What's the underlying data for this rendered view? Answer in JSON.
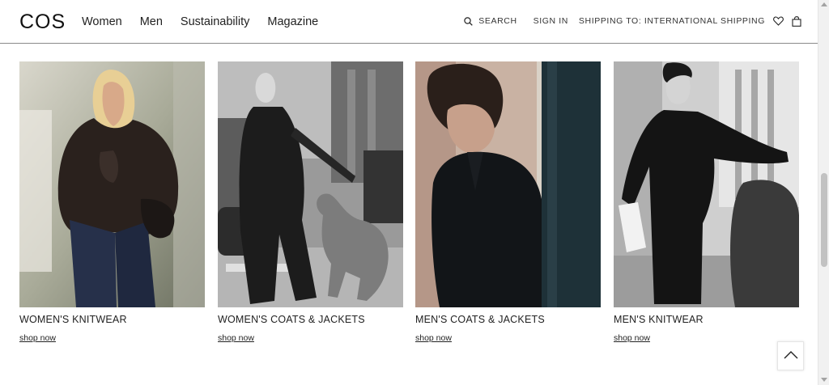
{
  "header": {
    "logo": "COS",
    "nav": [
      "Women",
      "Men",
      "Sustainability",
      "Magazine"
    ],
    "search_label": "SEARCH",
    "signin_label": "SIGN IN",
    "shipping_label": "SHIPPING TO: INTERNATIONAL SHIPPING"
  },
  "tiles": [
    {
      "title": "WOMEN'S KNITWEAR",
      "link": "shop now"
    },
    {
      "title": "WOMEN'S COATS & JACKETS",
      "link": "shop now"
    },
    {
      "title": "MEN'S COATS & JACKETS",
      "link": "shop now"
    },
    {
      "title": "MEN'S KNITWEAR",
      "link": "shop now"
    }
  ],
  "icons": {
    "search": "search-icon",
    "wishlist": "heart-icon",
    "bag": "bag-icon",
    "back_to_top": "chevron-up-icon"
  }
}
